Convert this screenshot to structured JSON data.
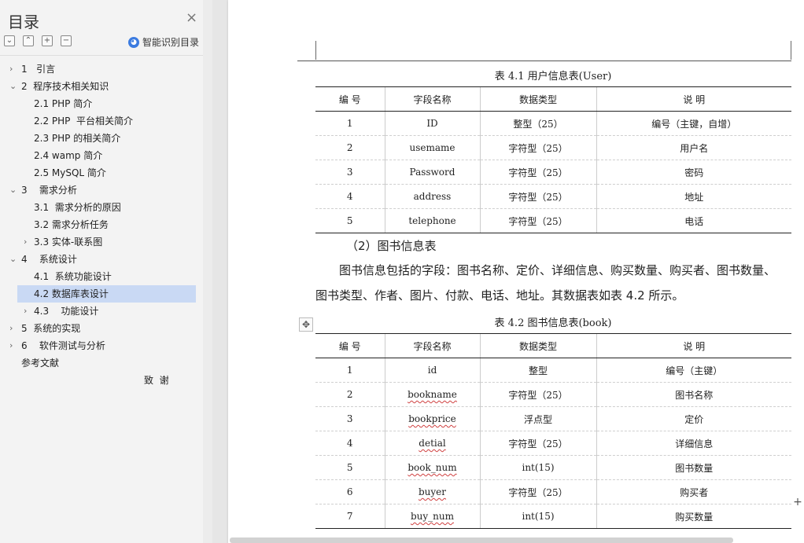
{
  "sidebar": {
    "title": "目录",
    "close_icon": "×",
    "tool_icons": [
      "collapse-icon",
      "expand-icon",
      "plus-icon",
      "minus-icon"
    ],
    "tool_glyphs": [
      "⌄",
      "⌃",
      "+",
      "−"
    ],
    "smart_label": "智能识别目录",
    "items": [
      {
        "label": "1   引言",
        "level": 1,
        "chevron": "›"
      },
      {
        "label": "2  程序技术相关知识",
        "level": 1,
        "chevron": "⌄"
      },
      {
        "label": "2.1 PHP 简介",
        "level": 2,
        "chevron": ""
      },
      {
        "label": "2.2 PHP  平台相关简介",
        "level": 2,
        "chevron": ""
      },
      {
        "label": "2.3 PHP 的相关简介",
        "level": 2,
        "chevron": ""
      },
      {
        "label": "2.4 wamp 简介",
        "level": 2,
        "chevron": ""
      },
      {
        "label": "2.5 MySQL 简介",
        "level": 2,
        "chevron": ""
      },
      {
        "label": "3    需求分析",
        "level": 1,
        "chevron": "⌄"
      },
      {
        "label": "3.1  需求分析的原因",
        "level": 2,
        "chevron": ""
      },
      {
        "label": "3.2 需求分析任务",
        "level": 2,
        "chevron": ""
      },
      {
        "label": "3.3 实体-联系图",
        "level": 2,
        "chevron": "›"
      },
      {
        "label": "4    系统设计",
        "level": 1,
        "chevron": "⌄"
      },
      {
        "label": "4.1  系统功能设计",
        "level": 2,
        "chevron": ""
      },
      {
        "label": "4.2 数据库表设计",
        "level": 2,
        "chevron": "",
        "selected": true
      },
      {
        "label": "4.3    功能设计",
        "level": 2,
        "chevron": "›"
      },
      {
        "label": "5  系统的实现",
        "level": 1,
        "chevron": "›"
      },
      {
        "label": "6    软件测试与分析",
        "level": 1,
        "chevron": "›"
      },
      {
        "label": "参考文献",
        "level": 1,
        "chevron": ""
      },
      {
        "label": "致  谢",
        "level": 0,
        "chevron": ""
      }
    ]
  },
  "document": {
    "table1": {
      "caption": "表 4.1 用户信息表(User)",
      "headers": [
        "编    号",
        "字段名称",
        "数据类型",
        "说    明"
      ],
      "rows": [
        [
          "1",
          "ID",
          "整型（25）",
          "编号（主键，自增）"
        ],
        [
          "2",
          "usemame",
          "字符型（25）",
          "用户名"
        ],
        [
          "3",
          "Password",
          "字符型（25）",
          "密码"
        ],
        [
          "4",
          "address",
          "字符型（25）",
          "地址"
        ],
        [
          "5",
          "telephone",
          "字符型（25）",
          "电话"
        ]
      ]
    },
    "subheading": "（2）图书信息表",
    "paragraph_line1": "图书信息包括的字段：图书名称、定价、详细信息、购买数量、购买者、图书数量、",
    "paragraph_line2": "图书类型、作者、图片、付款、电话、地址。其数据表如表 4.2 所示。",
    "table2": {
      "caption": "表 4.2 图书信息表(book)",
      "headers": [
        "编    号",
        "字段名称",
        "数据类型",
        "说    明"
      ],
      "rows": [
        [
          "1",
          "id",
          "整型",
          "编号（主键）"
        ],
        [
          "2",
          "bookname",
          "字符型（25）",
          "图书名称"
        ],
        [
          "3",
          "bookprice",
          "浮点型",
          "定价"
        ],
        [
          "4",
          "detial",
          "字符型（25）",
          "详细信息"
        ],
        [
          "5",
          "book_num",
          "int(15)",
          "图书数量"
        ],
        [
          "6",
          "buyer",
          "字符型（25）",
          "购买者"
        ],
        [
          "7",
          "buy_num",
          "int(15)",
          "购买数量"
        ]
      ]
    },
    "move_handle_icon": "✥",
    "plus_icon": "+"
  }
}
